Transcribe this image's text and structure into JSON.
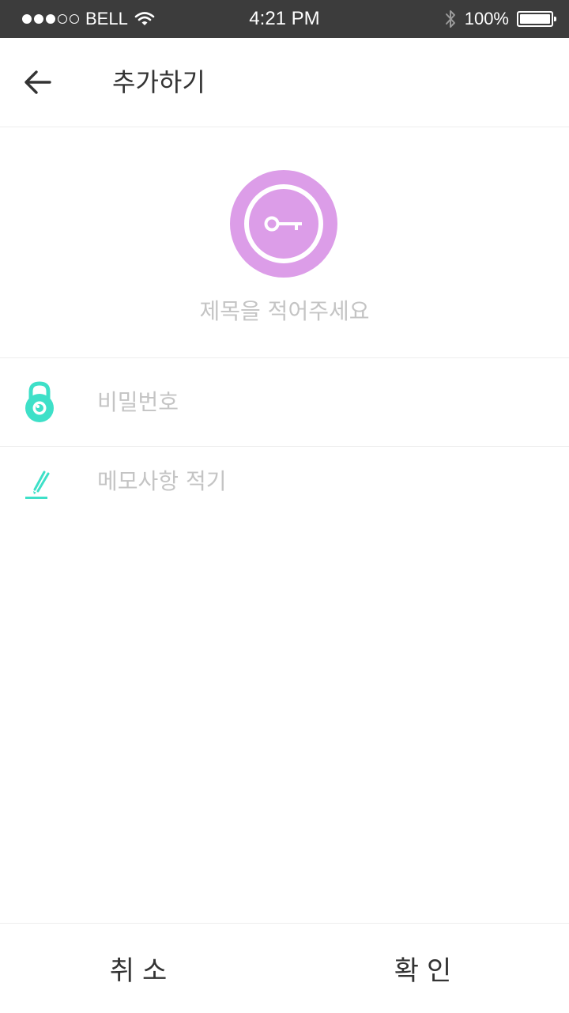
{
  "status_bar": {
    "carrier": "BELL",
    "time": "4:21 PM",
    "battery": "100%",
    "signal_bars_filled": 3,
    "signal_bars_total": 5
  },
  "header": {
    "title": "추가하기",
    "back_icon": "arrow-left-icon"
  },
  "item": {
    "icon": "key-icon",
    "icon_bg_color": "#dc9de8",
    "title_placeholder": "제목을 적어주세요",
    "title_value": ""
  },
  "fields": {
    "password": {
      "icon": "lock-icon",
      "placeholder": "비밀번호",
      "value": ""
    },
    "memo": {
      "icon": "pencil-icon",
      "placeholder": "메모사항 적기",
      "value": ""
    }
  },
  "accent_color": "#3ee0c8",
  "footer": {
    "cancel_label": "취소",
    "confirm_label": "확인"
  }
}
